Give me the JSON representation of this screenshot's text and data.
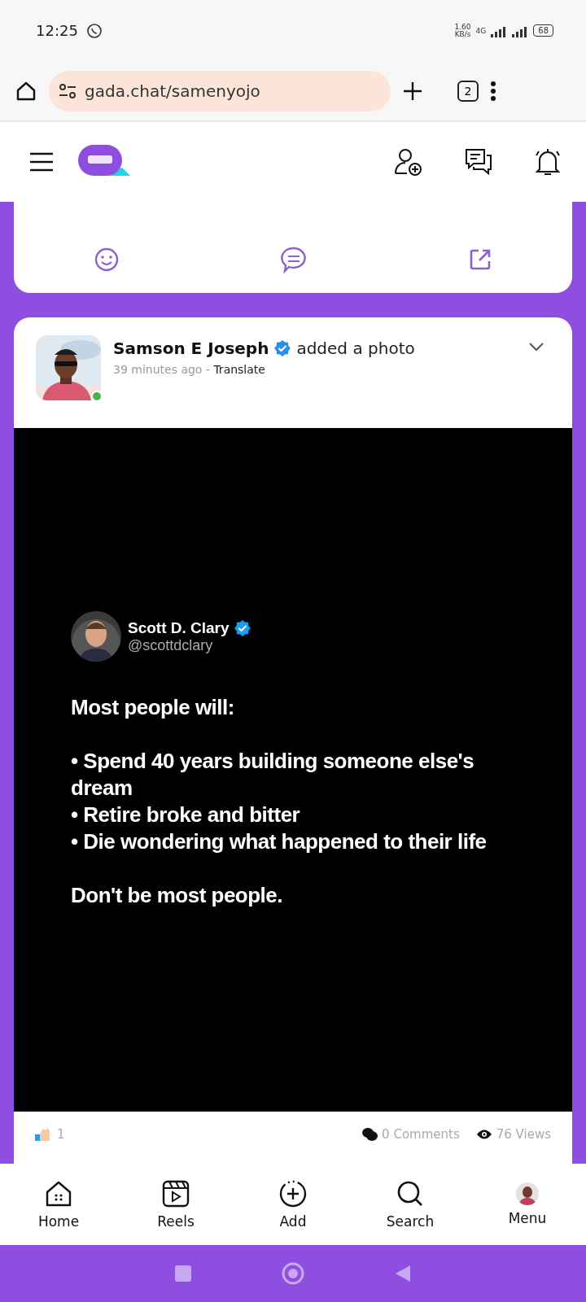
{
  "status_bar": {
    "time": "12:25",
    "speed": "1.60",
    "speed_unit": "KB/s",
    "network": "4G",
    "battery": "68"
  },
  "browser": {
    "url": "gada.chat/samenyojo",
    "tab_count": "2"
  },
  "previous_post": {
    "actions": [
      {
        "kind": "react"
      },
      {
        "kind": "comment"
      },
      {
        "kind": "share"
      }
    ]
  },
  "post": {
    "author": "Samson E Joseph",
    "verified": true,
    "action": "added a photo",
    "time": "39 minutes ago",
    "separator": " - ",
    "translate": "Translate",
    "online": true,
    "tweet": {
      "name": "Scott D. Clary",
      "verified": true,
      "handle": "@scottdclary",
      "paragraphs": [
        [
          "Most people will:"
        ],
        [
          "• Spend 40 years building someone else's dream",
          "• Retire broke and bitter",
          "• Die wondering what happened to their life"
        ],
        [
          "Don't be most people."
        ]
      ]
    },
    "reactions_count": "1",
    "comments": "0 Comments",
    "views": "76 Views"
  },
  "bottom_nav": [
    {
      "kind": "home",
      "label": "Home"
    },
    {
      "kind": "reels",
      "label": "Reels"
    },
    {
      "kind": "add",
      "label": "Add"
    },
    {
      "kind": "search",
      "label": "Search"
    },
    {
      "kind": "avatar",
      "label": "Menu"
    }
  ]
}
